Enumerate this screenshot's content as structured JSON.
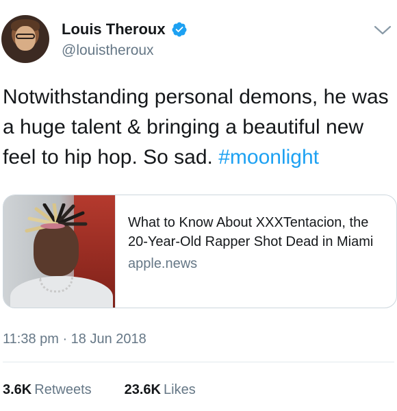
{
  "author": {
    "display_name": "Louis Theroux",
    "handle": "@louistheroux",
    "verified": true
  },
  "tweet": {
    "text": "Notwithstanding personal demons, he was a huge talent & bringing a beautiful new feel to hip hop. So sad. ",
    "hashtag": "#moonlight"
  },
  "card": {
    "title": "What to Know About XXXTentacion, the 20-Year-Old Rapper Shot Dead in Miami",
    "domain": "apple.news"
  },
  "meta": {
    "timestamp": "11:38 pm · 18 Jun 2018"
  },
  "stats": {
    "retweets_count": "3.6K",
    "retweets_label": "Retweets",
    "likes_count": "23.6K",
    "likes_label": "Likes"
  },
  "icons": {
    "verified": "verified-badge-icon",
    "caret": "chevron-down-icon"
  },
  "colors": {
    "link": "#1da1f2",
    "secondary_text": "#657786",
    "primary_text": "#14171a"
  }
}
